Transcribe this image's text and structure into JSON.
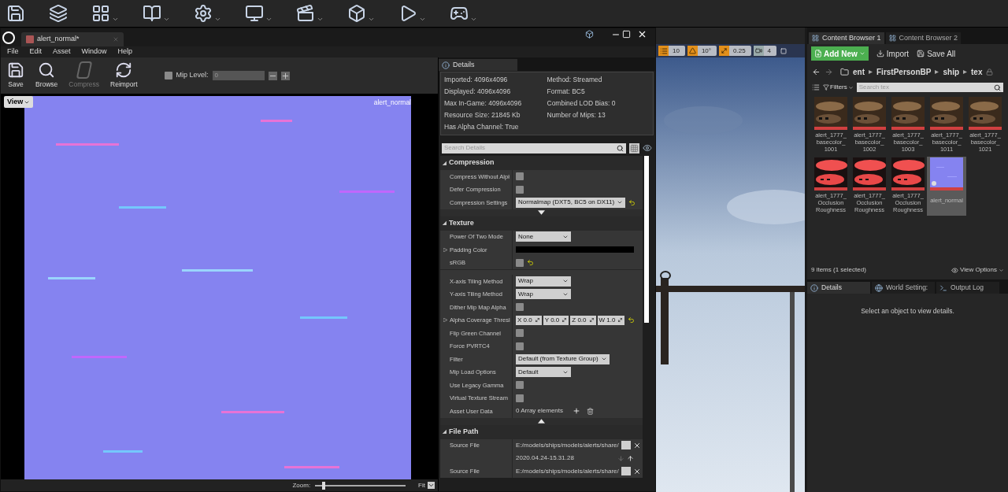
{
  "editor": {
    "tab": {
      "label": "alert_normal*"
    },
    "menu": [
      "File",
      "Edit",
      "Asset",
      "Window",
      "Help"
    ],
    "toolbar": [
      {
        "kind": "save",
        "label": "Save",
        "disabled": false
      },
      {
        "kind": "browse",
        "label": "Browse",
        "disabled": false
      },
      {
        "kind": "compress",
        "label": "Compress",
        "disabled": true
      },
      {
        "kind": "reimport",
        "label": "Reimport",
        "disabled": false
      }
    ],
    "mip_level": {
      "label": "Mip Level:",
      "checked": false,
      "value": "0"
    }
  },
  "viewport": {
    "view_button": "View",
    "asset_name": "alert_normal",
    "zoom_label": "Zoom:",
    "zoom": {
      "level": 0.08
    },
    "fit": "Fit"
  },
  "details": {
    "tab": "Details",
    "info": [
      "Imported: 4096x4096",
      "Method: Streamed",
      "Displayed: 4096x4096",
      "Format: BC5",
      "Max In-Game: 4096x4096",
      "Combined LOD Bias: 0",
      "Resource Size: 21845 Kb",
      "Number of Mips: 13",
      "Has Alpha Channel: True"
    ],
    "search_placeholder": "Search Details",
    "sections": [
      {
        "title": "Compression",
        "expanded": true,
        "advanced_shown": false,
        "rows": [
          {
            "kind": "checkbox",
            "label": "Compress Without Alpł",
            "checked": false
          },
          {
            "kind": "checkbox",
            "label": "Defer Compression",
            "checked": false
          },
          {
            "kind": "dropdown",
            "label": "Compression Settings",
            "value": "Normalmap (DXT5, BC5 on DX11)",
            "reset": true
          }
        ]
      },
      {
        "title": "Texture",
        "expanded": true,
        "advanced_shown": true,
        "rows": [
          {
            "kind": "dropdown",
            "label": "Power Of Two Mode",
            "value": "None"
          },
          {
            "kind": "color",
            "label": "Padding Color",
            "color": "#000000"
          },
          {
            "kind": "checkbox",
            "label": "sRGB",
            "checked": false,
            "reset": true
          }
        ],
        "advanced_rows": [
          {
            "kind": "dropdown",
            "label": "X-axis Tiling Method",
            "value": "Wrap"
          },
          {
            "kind": "dropdown",
            "label": "Y-axis Tiling Method",
            "value": "Wrap"
          },
          {
            "kind": "checkbox",
            "label": "Dither Mip Map Alpha",
            "checked": false
          },
          {
            "kind": "vector",
            "label": "Alpha Coverage Thresl",
            "reset": true,
            "components": [
              {
                "axis": "X",
                "value": "0.0"
              },
              {
                "axis": "Y",
                "value": "0.0"
              },
              {
                "axis": "Z",
                "value": "0.0"
              },
              {
                "axis": "W",
                "value": "1.0"
              }
            ]
          },
          {
            "kind": "checkbox",
            "label": "Flip Green Channel",
            "checked": false
          },
          {
            "kind": "checkbox",
            "label": "Force PVRTC4",
            "checked": false
          },
          {
            "kind": "dropdown",
            "label": "Filter",
            "value": "Default (from Texture Group)"
          },
          {
            "kind": "dropdown",
            "label": "Mip Load Options",
            "value": "Default"
          },
          {
            "kind": "checkbox",
            "label": "Use Legacy Gamma",
            "checked": false
          },
          {
            "kind": "checkbox",
            "label": "Virtual Texture Stream",
            "checked": false
          },
          {
            "kind": "array",
            "label": "Asset User Data",
            "value": "0 Array elements"
          }
        ]
      },
      {
        "title": "File Path",
        "expanded": true,
        "rows": [
          {
            "kind": "path",
            "label": "Source File",
            "value": "E:/models/ships/models/alerts/share/"
          },
          {
            "kind": "date",
            "value": "2020.04.24-15.31.28"
          },
          {
            "kind": "path",
            "label": "Source File",
            "value": "E:/models/ships/models/alerts/share/"
          }
        ]
      }
    ]
  },
  "level_viewport": {
    "toolbar": [
      {
        "kind": "grid",
        "value": "10",
        "on": true
      },
      {
        "kind": "rotate",
        "value": "10°",
        "on": true
      },
      {
        "kind": "scale",
        "value": "0.25",
        "on": true
      },
      {
        "kind": "speed",
        "value": "4",
        "on": false
      }
    ]
  },
  "content_browser": {
    "tabs": [
      {
        "label": "Content Browser 1",
        "selected": true
      },
      {
        "label": "Content Browser 2",
        "selected": false
      }
    ],
    "add_new": "Add New",
    "import": "Import",
    "save_all": "Save All",
    "path": [
      "ent",
      "FirstPersonBP",
      "ship",
      "tex"
    ],
    "filters": "Filters",
    "search_placeholder": "Search tex",
    "assets": [
      {
        "kind": "basecolor",
        "lines": [
          "alert_1777_",
          "basecolor_",
          "1001"
        ],
        "selected": false
      },
      {
        "kind": "basecolor",
        "lines": [
          "alert_1777_",
          "basecolor_",
          "1002"
        ],
        "selected": false
      },
      {
        "kind": "basecolor",
        "lines": [
          "alert_1777_",
          "basecolor_",
          "1003"
        ],
        "selected": false
      },
      {
        "kind": "basecolor",
        "lines": [
          "alert_1777_",
          "basecolor_",
          "1011"
        ],
        "selected": false
      },
      {
        "kind": "basecolor",
        "lines": [
          "alert_1777_",
          "basecolor_",
          "1021"
        ],
        "selected": false
      },
      {
        "kind": "occlusion",
        "lines": [
          "alert_1777_",
          "Occlusion",
          "Roughness"
        ],
        "selected": false
      },
      {
        "kind": "occlusion",
        "lines": [
          "alert_1777_",
          "Occlusion",
          "Roughness"
        ],
        "selected": false
      },
      {
        "kind": "occlusion",
        "lines": [
          "alert_1777_",
          "Occlusion",
          "Roughness"
        ],
        "selected": false
      },
      {
        "kind": "normal",
        "lines": [
          "alert_normal"
        ],
        "selected": true
      }
    ],
    "status": "9 items (1 selected)",
    "view_options": "View Options"
  },
  "bottom_panel": {
    "tabs": [
      {
        "kind": "details",
        "label": "Details",
        "selected": true
      },
      {
        "kind": "world",
        "label": "World Setting:",
        "selected": false
      },
      {
        "kind": "log",
        "label": "Output Log",
        "selected": false
      }
    ],
    "message": "Select an object to view details."
  }
}
